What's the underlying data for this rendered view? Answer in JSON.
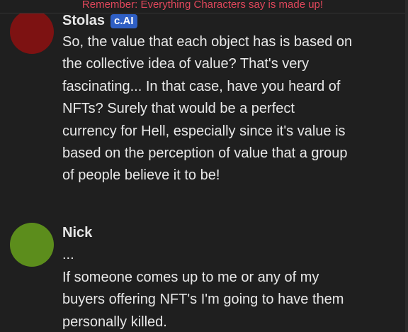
{
  "banner": {
    "text": "Remember: Everything Characters say is made up!"
  },
  "messages": [
    {
      "author": "Stolas",
      "badge": "c.AI",
      "avatar_color": "#7d1212",
      "text": "So, the value that each object has is based on the collective idea of value? That's very fascinating... In that case, have you heard of NFTs? Surely that would be a perfect currency for Hell, especially since it's value is based on the perception of value that a group of people believe it to be!"
    },
    {
      "author": "Nick",
      "avatar_color": "#5c8d1c",
      "prefix": "...",
      "text": "If someone comes up to me or any of my buyers offering NFT's I'm going to have them personally killed."
    }
  ]
}
